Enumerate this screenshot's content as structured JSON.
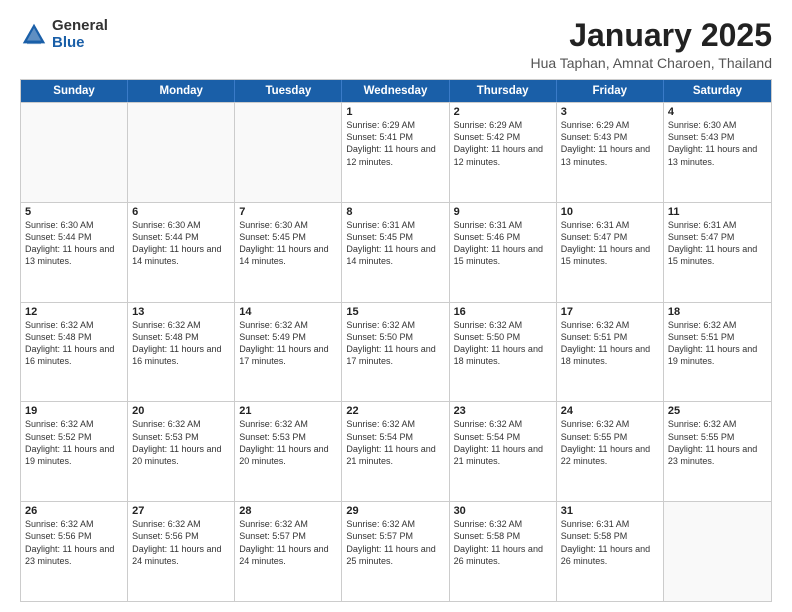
{
  "logo": {
    "general": "General",
    "blue": "Blue"
  },
  "title": "January 2025",
  "location": "Hua Taphan, Amnat Charoen, Thailand",
  "days": [
    "Sunday",
    "Monday",
    "Tuesday",
    "Wednesday",
    "Thursday",
    "Friday",
    "Saturday"
  ],
  "weeks": [
    [
      {
        "day": "",
        "empty": true
      },
      {
        "day": "",
        "empty": true
      },
      {
        "day": "",
        "empty": true
      },
      {
        "day": "1",
        "sunrise": "6:29 AM",
        "sunset": "5:41 PM",
        "daylight": "11 hours and 12 minutes."
      },
      {
        "day": "2",
        "sunrise": "6:29 AM",
        "sunset": "5:42 PM",
        "daylight": "11 hours and 12 minutes."
      },
      {
        "day": "3",
        "sunrise": "6:29 AM",
        "sunset": "5:43 PM",
        "daylight": "11 hours and 13 minutes."
      },
      {
        "day": "4",
        "sunrise": "6:30 AM",
        "sunset": "5:43 PM",
        "daylight": "11 hours and 13 minutes."
      }
    ],
    [
      {
        "day": "5",
        "sunrise": "6:30 AM",
        "sunset": "5:44 PM",
        "daylight": "11 hours and 13 minutes."
      },
      {
        "day": "6",
        "sunrise": "6:30 AM",
        "sunset": "5:44 PM",
        "daylight": "11 hours and 14 minutes."
      },
      {
        "day": "7",
        "sunrise": "6:30 AM",
        "sunset": "5:45 PM",
        "daylight": "11 hours and 14 minutes."
      },
      {
        "day": "8",
        "sunrise": "6:31 AM",
        "sunset": "5:45 PM",
        "daylight": "11 hours and 14 minutes."
      },
      {
        "day": "9",
        "sunrise": "6:31 AM",
        "sunset": "5:46 PM",
        "daylight": "11 hours and 15 minutes."
      },
      {
        "day": "10",
        "sunrise": "6:31 AM",
        "sunset": "5:47 PM",
        "daylight": "11 hours and 15 minutes."
      },
      {
        "day": "11",
        "sunrise": "6:31 AM",
        "sunset": "5:47 PM",
        "daylight": "11 hours and 15 minutes."
      }
    ],
    [
      {
        "day": "12",
        "sunrise": "6:32 AM",
        "sunset": "5:48 PM",
        "daylight": "11 hours and 16 minutes."
      },
      {
        "day": "13",
        "sunrise": "6:32 AM",
        "sunset": "5:48 PM",
        "daylight": "11 hours and 16 minutes."
      },
      {
        "day": "14",
        "sunrise": "6:32 AM",
        "sunset": "5:49 PM",
        "daylight": "11 hours and 17 minutes."
      },
      {
        "day": "15",
        "sunrise": "6:32 AM",
        "sunset": "5:50 PM",
        "daylight": "11 hours and 17 minutes."
      },
      {
        "day": "16",
        "sunrise": "6:32 AM",
        "sunset": "5:50 PM",
        "daylight": "11 hours and 18 minutes."
      },
      {
        "day": "17",
        "sunrise": "6:32 AM",
        "sunset": "5:51 PM",
        "daylight": "11 hours and 18 minutes."
      },
      {
        "day": "18",
        "sunrise": "6:32 AM",
        "sunset": "5:51 PM",
        "daylight": "11 hours and 19 minutes."
      }
    ],
    [
      {
        "day": "19",
        "sunrise": "6:32 AM",
        "sunset": "5:52 PM",
        "daylight": "11 hours and 19 minutes."
      },
      {
        "day": "20",
        "sunrise": "6:32 AM",
        "sunset": "5:53 PM",
        "daylight": "11 hours and 20 minutes."
      },
      {
        "day": "21",
        "sunrise": "6:32 AM",
        "sunset": "5:53 PM",
        "daylight": "11 hours and 20 minutes."
      },
      {
        "day": "22",
        "sunrise": "6:32 AM",
        "sunset": "5:54 PM",
        "daylight": "11 hours and 21 minutes."
      },
      {
        "day": "23",
        "sunrise": "6:32 AM",
        "sunset": "5:54 PM",
        "daylight": "11 hours and 21 minutes."
      },
      {
        "day": "24",
        "sunrise": "6:32 AM",
        "sunset": "5:55 PM",
        "daylight": "11 hours and 22 minutes."
      },
      {
        "day": "25",
        "sunrise": "6:32 AM",
        "sunset": "5:55 PM",
        "daylight": "11 hours and 23 minutes."
      }
    ],
    [
      {
        "day": "26",
        "sunrise": "6:32 AM",
        "sunset": "5:56 PM",
        "daylight": "11 hours and 23 minutes."
      },
      {
        "day": "27",
        "sunrise": "6:32 AM",
        "sunset": "5:56 PM",
        "daylight": "11 hours and 24 minutes."
      },
      {
        "day": "28",
        "sunrise": "6:32 AM",
        "sunset": "5:57 PM",
        "daylight": "11 hours and 24 minutes."
      },
      {
        "day": "29",
        "sunrise": "6:32 AM",
        "sunset": "5:57 PM",
        "daylight": "11 hours and 25 minutes."
      },
      {
        "day": "30",
        "sunrise": "6:32 AM",
        "sunset": "5:58 PM",
        "daylight": "11 hours and 26 minutes."
      },
      {
        "day": "31",
        "sunrise": "6:31 AM",
        "sunset": "5:58 PM",
        "daylight": "11 hours and 26 minutes."
      },
      {
        "day": "",
        "empty": true
      }
    ]
  ]
}
